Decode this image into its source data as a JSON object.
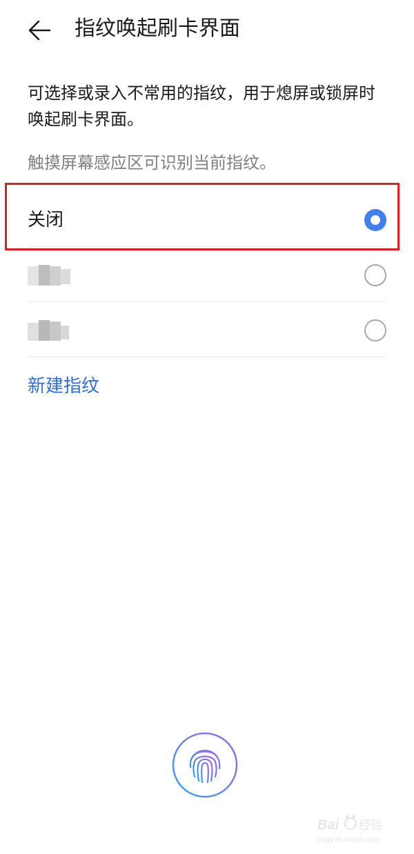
{
  "header": {
    "back_icon": "arrow-left-icon",
    "title": "指纹唤起刷卡界面"
  },
  "description": "可选择或录入不常用的指纹，用于熄屏或锁屏时唤起刷卡界面。",
  "hint": "触摸屏幕感应区可识别当前指纹。",
  "options": [
    {
      "label": "关闭",
      "selected": true
    },
    {
      "label": "",
      "selected": false
    },
    {
      "label": "",
      "selected": false
    }
  ],
  "new_fingerprint_label": "新建指纹",
  "fingerprint_icon": "fingerprint-icon",
  "colors": {
    "accent": "#3f7ff0",
    "link": "#2e6fe0",
    "highlight_border": "#e02020",
    "fingerprint_gradient_start": "#2ea3f2",
    "fingerprint_gradient_end": "#a463f2"
  },
  "watermark": {
    "brand": "Bai",
    "brand_cn": "经验",
    "url": "jingyan.baidu.com"
  }
}
